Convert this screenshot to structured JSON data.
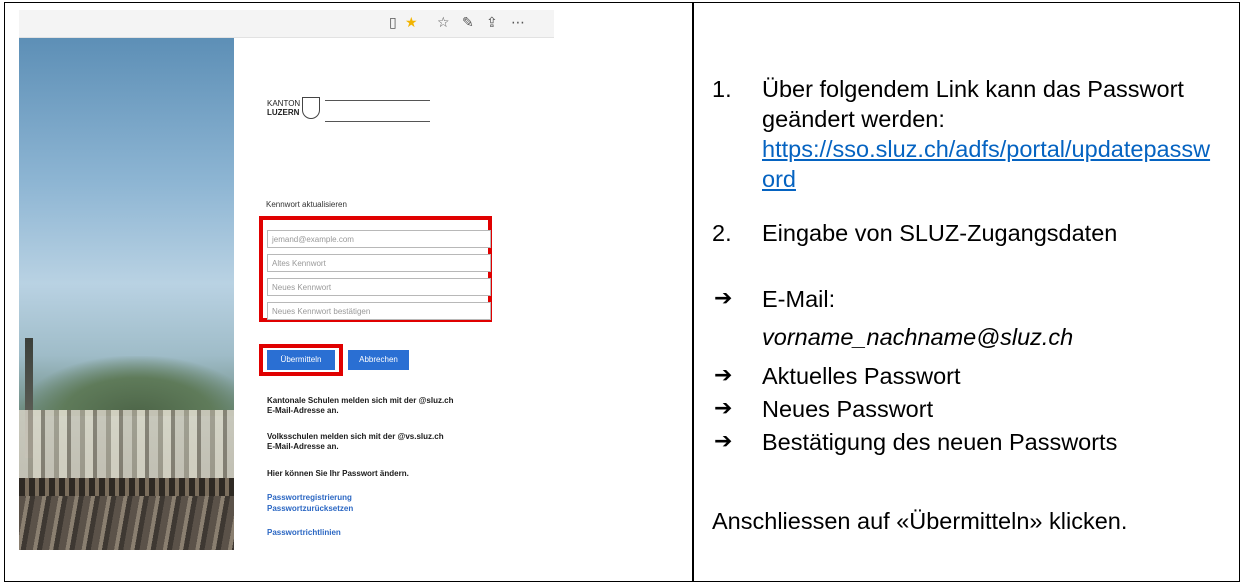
{
  "screenshot": {
    "toolbar_icons": [
      "reading-view-icon",
      "favorite-star-icon",
      "favorites-list-icon",
      "pen-icon",
      "share-icon",
      "more-icon"
    ],
    "logo": {
      "line1": "KANTON",
      "line2": "LUZERN"
    },
    "form": {
      "title": "Kennwort aktualisieren",
      "email_placeholder": "jemand@example.com",
      "old_password_placeholder": "Altes Kennwort",
      "new_password_placeholder": "Neues Kennwort",
      "confirm_password_placeholder": "Neues Kennwort bestätigen",
      "submit_label": "Übermitteln",
      "cancel_label": "Abbrechen"
    },
    "info": {
      "kantonal_1": "Kantonale Schulen melden sich mit der @sluz.ch",
      "kantonal_2": "E-Mail-Adresse an.",
      "volk_1": "Volksschulen melden sich mit der @vs.sluz.ch",
      "volk_2": "E-Mail-Adresse an.",
      "change_here": "Hier können Sie Ihr Passwort ändern."
    },
    "links": {
      "registration": "Passwortregistrierung",
      "reset": "Passwortzurücksetzen",
      "guidelines": "Passwortrichtlinien"
    },
    "highlight_color": "#e00000",
    "button_color": "#2a6fd3"
  },
  "instructions": {
    "step1_number": "1.",
    "step1_text": "Über folgendem Link kann das Passwort geändert werden:",
    "step1_link": "https://sso.sluz.ch/adfs/portal/updatepassword",
    "step2_number": "2.",
    "step2_text": "Eingabe von SLUZ-Zugangsdaten",
    "arrow": "➔",
    "email_label": "E-Mail:",
    "email_value": "vorname_nachname@sluz.ch",
    "current_password": "Aktuelles Passwort",
    "new_password": "Neues Passwort",
    "confirm_password": "Bestätigung des neuen Passworts",
    "final": "Anschliessen auf «Übermitteln» klicken.",
    "link_color": "#0563c1"
  }
}
